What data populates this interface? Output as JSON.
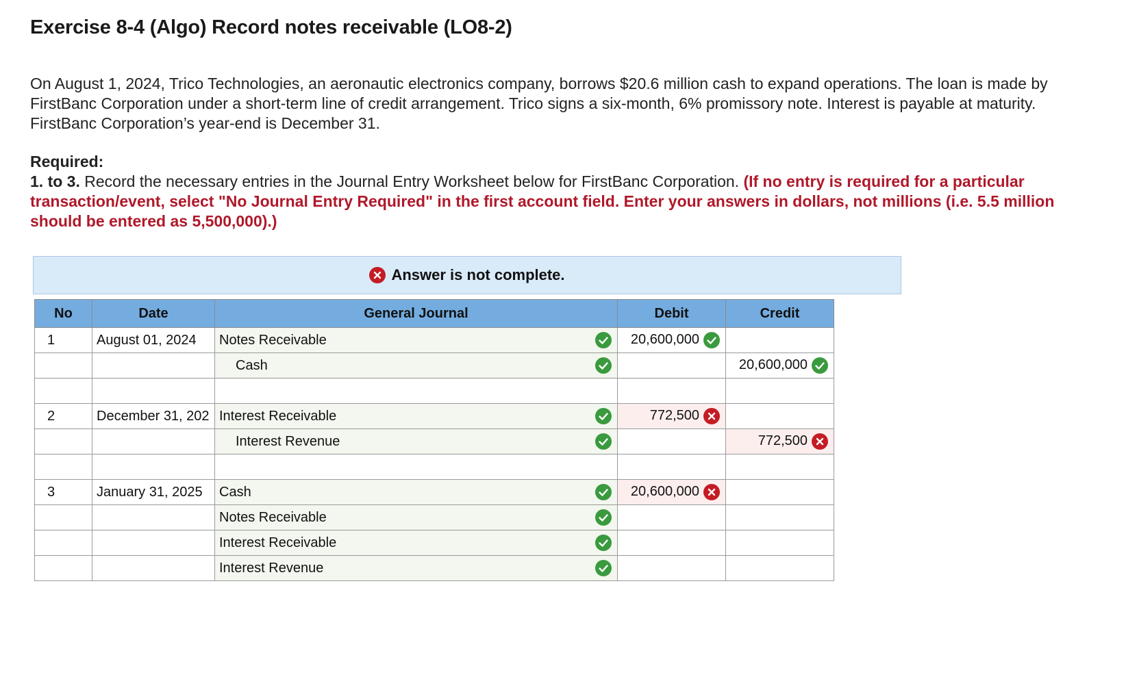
{
  "exercise": {
    "title": "Exercise 8-4 (Algo) Record notes receivable (LO8-2)",
    "problem_text": "On August 1, 2024, Trico Technologies, an aeronautic electronics company, borrows $20.6 million cash to expand operations. The loan is made by FirstBanc Corporation under a short-term line of credit arrangement. Trico signs a six-month, 6% promissory note. Interest is payable at maturity. FirstBanc Corporation’s year-end is December 31.",
    "required_heading": "Required:",
    "required_number": "1. to 3.",
    "required_text": "Record the necessary entries in the Journal Entry Worksheet below for FirstBanc Corporation.",
    "required_instructions": "(If no entry is required for a particular transaction/event, select \"No Journal Entry Required\" in the first account field. Enter your answers in dollars, not millions (i.e. 5.5 million should be entered as 5,500,000).)"
  },
  "answer_status": {
    "text": "Answer is not complete.",
    "icon": "x-circle-icon",
    "color": "#c41c25"
  },
  "journal": {
    "headers": {
      "no": "No",
      "date": "Date",
      "general_journal": "General Journal",
      "debit": "Debit",
      "credit": "Credit"
    },
    "rows": [
      {
        "no": "1",
        "date": "August 01, 2024",
        "account": "Notes Receivable",
        "indent": false,
        "account_status": "correct",
        "debit": "20,600,000",
        "debit_status": "correct",
        "credit": "",
        "credit_status": ""
      },
      {
        "no": "",
        "date": "",
        "account": "Cash",
        "indent": true,
        "account_status": "correct",
        "debit": "",
        "debit_status": "",
        "credit": "20,600,000",
        "credit_status": "correct"
      },
      {
        "no": "",
        "date": "",
        "account": "",
        "indent": false,
        "account_status": "",
        "debit": "",
        "debit_status": "",
        "credit": "",
        "credit_status": ""
      },
      {
        "no": "2",
        "date": "December 31, 202",
        "account": "Interest Receivable",
        "indent": false,
        "account_status": "correct",
        "debit": "772,500",
        "debit_status": "incorrect",
        "credit": "",
        "credit_status": ""
      },
      {
        "no": "",
        "date": "",
        "account": "Interest Revenue",
        "indent": true,
        "account_status": "correct",
        "debit": "",
        "debit_status": "",
        "credit": "772,500",
        "credit_status": "incorrect"
      },
      {
        "no": "",
        "date": "",
        "account": "",
        "indent": false,
        "account_status": "",
        "debit": "",
        "debit_status": "",
        "credit": "",
        "credit_status": ""
      },
      {
        "no": "3",
        "date": "January 31, 2025",
        "account": "Cash",
        "indent": false,
        "account_status": "correct",
        "debit": "20,600,000",
        "debit_status": "incorrect",
        "credit": "",
        "credit_status": ""
      },
      {
        "no": "",
        "date": "",
        "account": "Notes Receivable",
        "indent": false,
        "account_status": "correct",
        "debit": "",
        "debit_status": "",
        "credit": "",
        "credit_status": ""
      },
      {
        "no": "",
        "date": "",
        "account": "Interest Receivable",
        "indent": false,
        "account_status": "correct",
        "debit": "",
        "debit_status": "",
        "credit": "",
        "credit_status": ""
      },
      {
        "no": "",
        "date": "",
        "account": "Interest Revenue",
        "indent": false,
        "account_status": "correct",
        "debit": "",
        "debit_status": "",
        "credit": "",
        "credit_status": ""
      }
    ]
  },
  "colors": {
    "header_blue": "#74ace0",
    "banner_blue": "#d9eaf8",
    "correct_green": "#3a9a3e",
    "incorrect_red": "#c41c25",
    "instruction_red": "#b0182a"
  }
}
